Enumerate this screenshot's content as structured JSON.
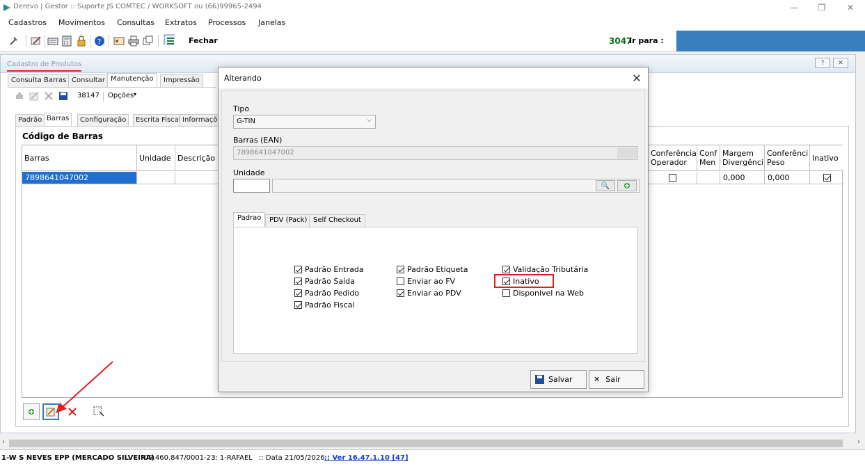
{
  "window": {
    "title": "Derevo | Gestor :: Suporte JS COMTEC / WORKSOFT ou (66)99965-2494"
  },
  "menu": [
    "Cadastros",
    "Movimentos",
    "Consultas",
    "Extratos",
    "Processos",
    "Janelas"
  ],
  "toolbar": {
    "fechar": "Fechar",
    "count": "3047",
    "ir_para": "Ir para :"
  },
  "child": {
    "title": "Cadastro de Produtos",
    "tabs": [
      "Consulta Barras",
      "Consultar",
      "Manutenção",
      "Impressão"
    ],
    "record_id": "38147",
    "opcoes": "Opções",
    "subtabs": [
      "Padrão",
      "Barras",
      "Configuração",
      "Escrita Fiscal",
      "Informaçõ"
    ],
    "section_title": "Código de Barras",
    "grid": {
      "headers": {
        "barras": "Barras",
        "unidade": "Unidade",
        "descricao": "Descrição",
        "conf_operador": "Conferência Operador",
        "conf_men": "Conf Men",
        "margem": "Margem Divergênci",
        "conf_peso": "Conferênci Peso",
        "inativo": "Inativo"
      },
      "row": {
        "barras": "7898641047002",
        "margem": "0,000",
        "conf_peso": "0,000",
        "conf_operador_checked": false,
        "inativo_checked": true
      }
    }
  },
  "dialog": {
    "title": "Alterando",
    "tipo_label": "Tipo",
    "tipo_value": "G-TIN",
    "ean_label": "Barras (EAN)",
    "ean_value": "7898641047002",
    "unidade_label": "Unidade",
    "tabs": [
      "Padrao",
      "PDV (Pack)",
      "Self Checkout"
    ],
    "options": [
      {
        "label": "Padrão Entrada",
        "checked": true
      },
      {
        "label": "Padrão Saída",
        "checked": true
      },
      {
        "label": "Padrão Pedido",
        "checked": true
      },
      {
        "label": "Padrão Fiscal",
        "checked": true
      },
      {
        "label": "Padrão Etiqueta",
        "checked": true
      },
      {
        "label": "Enviar ao FV",
        "checked": false
      },
      {
        "label": "Enviar ao PDV",
        "checked": true
      },
      {
        "label": "Validação Tributária",
        "checked": true
      },
      {
        "label": "Inativo",
        "checked": true
      },
      {
        "label": "Disponivel na Web",
        "checked": false
      }
    ],
    "salvar": "Salvar",
    "sair": "Sair"
  },
  "status": {
    "company": "1-W S NEVES EPP (MERCADO SILVEIRA)",
    "cnpj": "09.460.847/0001-23",
    "user": ":: 1-RAFAEL",
    "date": ":: Data 21/05/2026",
    "version": ":: Ver 16.47.1.10 [47]"
  },
  "colors": {
    "accent": "#3a7fbf",
    "selection": "#1f6fd1",
    "annotation": "#e0201e",
    "count_green": "#0b6b1c"
  }
}
